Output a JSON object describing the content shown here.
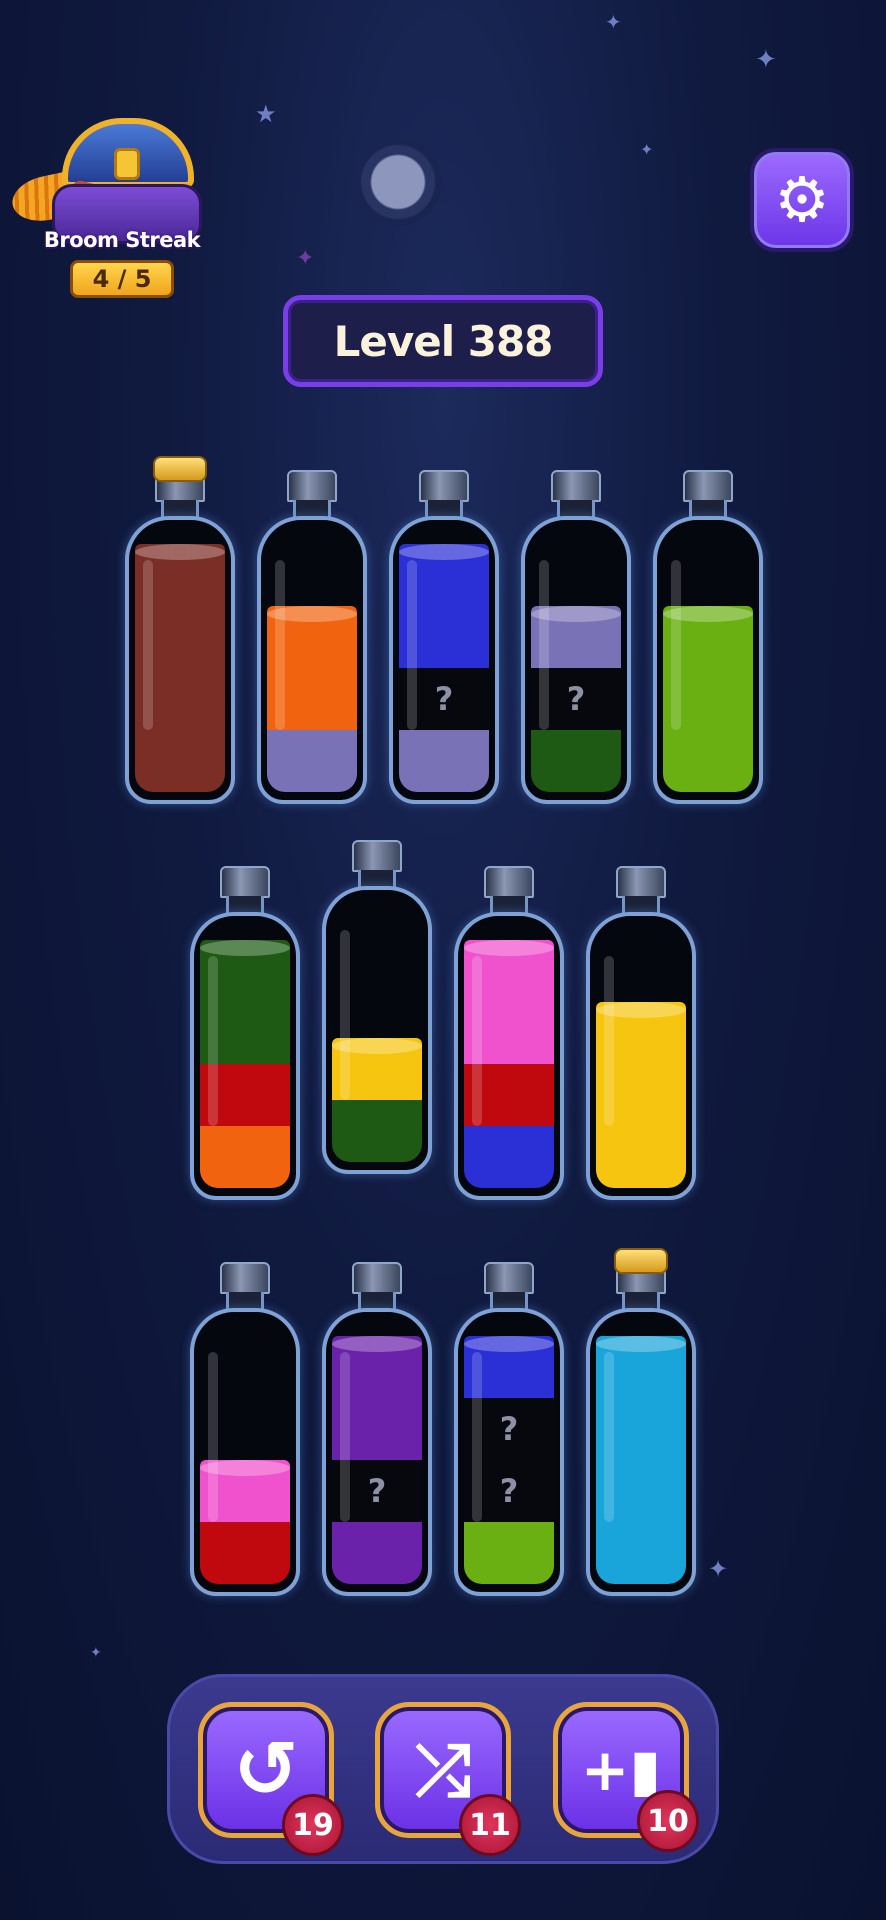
{
  "streak": {
    "label": "Broom Streak",
    "count": "4 / 5"
  },
  "level": {
    "label": "Level 388"
  },
  "settings": {
    "icon": "gear-icon"
  },
  "bottles": [
    {
      "corked": true,
      "layers": [
        "#7a2e26",
        "#7a2e26",
        "#7a2e26",
        "#7a2e26"
      ]
    },
    {
      "corked": false,
      "layers": [
        "#7a72b6",
        "#f1630e",
        "#f1630e"
      ]
    },
    {
      "corked": false,
      "layers": [
        "#7a72b6",
        "?",
        "#2a2fd6",
        "#2a2fd6"
      ]
    },
    {
      "corked": false,
      "layers": [
        "#1e5a14",
        "?",
        "#7a72b6"
      ]
    },
    {
      "corked": false,
      "layers": [
        "#6ab012",
        "#6ab012",
        "#6ab012"
      ]
    },
    {
      "corked": false,
      "layers": [
        "#f1630e",
        "#c0090e",
        "#1e5a14",
        "#1e5a14"
      ]
    },
    {
      "corked": false,
      "layers": [
        "#1e5a14",
        "#f5c510"
      ]
    },
    {
      "corked": false,
      "layers": [
        "#2a2fd6",
        "#c0090e",
        "#f052ce",
        "#f052ce"
      ]
    },
    {
      "corked": false,
      "layers": [
        "#f5c510",
        "#f5c510",
        "#f5c510"
      ]
    },
    {
      "corked": false,
      "layers": [
        "#c0090e",
        "#f052ce"
      ]
    },
    {
      "corked": false,
      "layers": [
        "#6a22aa",
        "?",
        "#6a22aa",
        "#6a22aa"
      ]
    },
    {
      "corked": false,
      "layers": [
        "#6ab012",
        "?",
        "?",
        "#2a2fd6"
      ]
    },
    {
      "corked": true,
      "layers": [
        "#19a4da",
        "#19a4da",
        "#19a4da",
        "#19a4da"
      ]
    }
  ],
  "unknown_mark": "?",
  "buttons": {
    "undo": {
      "icon": "undo-icon",
      "count": "19"
    },
    "shuffle": {
      "icon": "shuffle-icon",
      "count": "11"
    },
    "add_bottle": {
      "icon": "add-bottle-icon",
      "count": "10"
    }
  }
}
